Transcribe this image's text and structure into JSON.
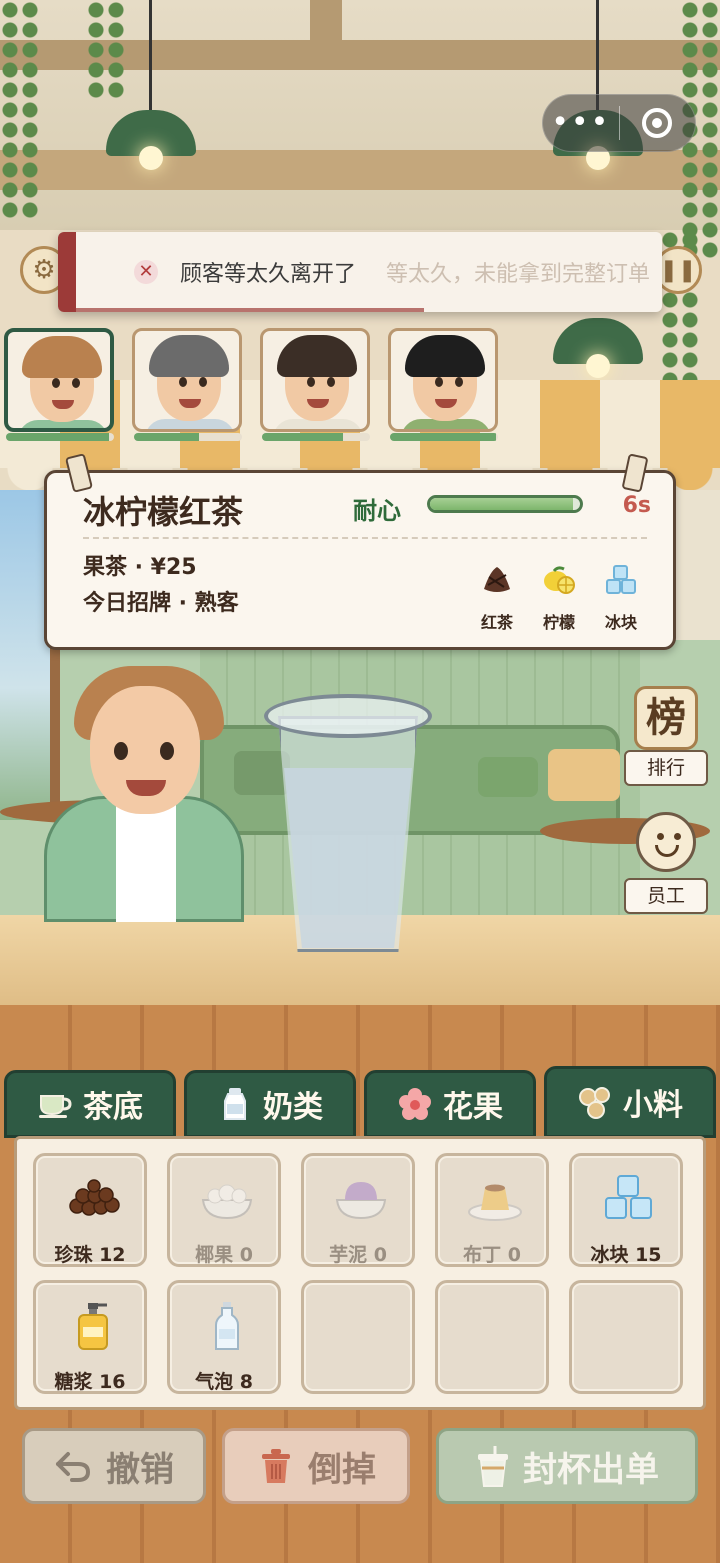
{
  "capsule": {
    "more_icon": "more-dots-icon",
    "close_icon": "target-icon"
  },
  "toast": {
    "message": "顾客等太久离开了",
    "overlap_text": "等太久，未能拿到完整订单",
    "timer_remaining": 0.6
  },
  "customers": [
    {
      "name": "curly-hair-youth",
      "patience": 0.95,
      "active": true
    },
    {
      "name": "gray-hair-man",
      "patience": 0.6,
      "active": false
    },
    {
      "name": "mustache-man",
      "patience": 0.75,
      "active": false
    },
    {
      "name": "black-hair-boy",
      "patience": 0.98,
      "active": false
    }
  ],
  "order": {
    "drink_name": "冰柠檬红茶",
    "patience_label": "耐心",
    "patience": 0.95,
    "seconds": "6s",
    "category_price": "果茶 · ¥25",
    "tags": "今日招牌 · 熟客",
    "ingredients": [
      {
        "label": "红茶",
        "icon": "black-tea-leaves-icon"
      },
      {
        "label": "柠檬",
        "icon": "lemon-icon"
      },
      {
        "label": "冰块",
        "icon": "ice-cube-icon"
      }
    ]
  },
  "side": {
    "rank_char": "榜",
    "rank_label": "排行",
    "staff_label": "员工"
  },
  "tabs": [
    {
      "label": "茶底",
      "icon": "teacup-icon",
      "active": false
    },
    {
      "label": "奶类",
      "icon": "milk-bottle-icon",
      "active": false
    },
    {
      "label": "花果",
      "icon": "flower-icon",
      "active": false
    },
    {
      "label": "小料",
      "icon": "toppings-icon",
      "active": true
    }
  ],
  "inventory": [
    {
      "name": "珍珠",
      "count": "12",
      "label": "珍珠 12",
      "icon": "pearls-icon",
      "available": true
    },
    {
      "name": "椰果",
      "count": "0",
      "label": "椰果 0",
      "icon": "coconut-jelly-icon",
      "available": false
    },
    {
      "name": "芋泥",
      "count": "0",
      "label": "芋泥 0",
      "icon": "taro-paste-icon",
      "available": false
    },
    {
      "name": "布丁",
      "count": "0",
      "label": "布丁 0",
      "icon": "pudding-icon",
      "available": false
    },
    {
      "name": "冰块",
      "count": "15",
      "label": "冰块 15",
      "icon": "ice-cube-icon",
      "available": true
    },
    {
      "name": "糖浆",
      "count": "16",
      "label": "糖浆 16",
      "icon": "syrup-bottle-icon",
      "available": true
    },
    {
      "name": "气泡",
      "count": "8",
      "label": "气泡 8",
      "icon": "soda-bottle-icon",
      "available": true
    }
  ],
  "actions": {
    "undo_label": "撤销",
    "discard_label": "倒掉",
    "seal_label": "封杯出单"
  },
  "colors": {
    "tab_green": "#2f5a44",
    "patience_green": "#7db66c",
    "alert_red": "#9c3a38",
    "seconds_red": "#c45a4f"
  }
}
